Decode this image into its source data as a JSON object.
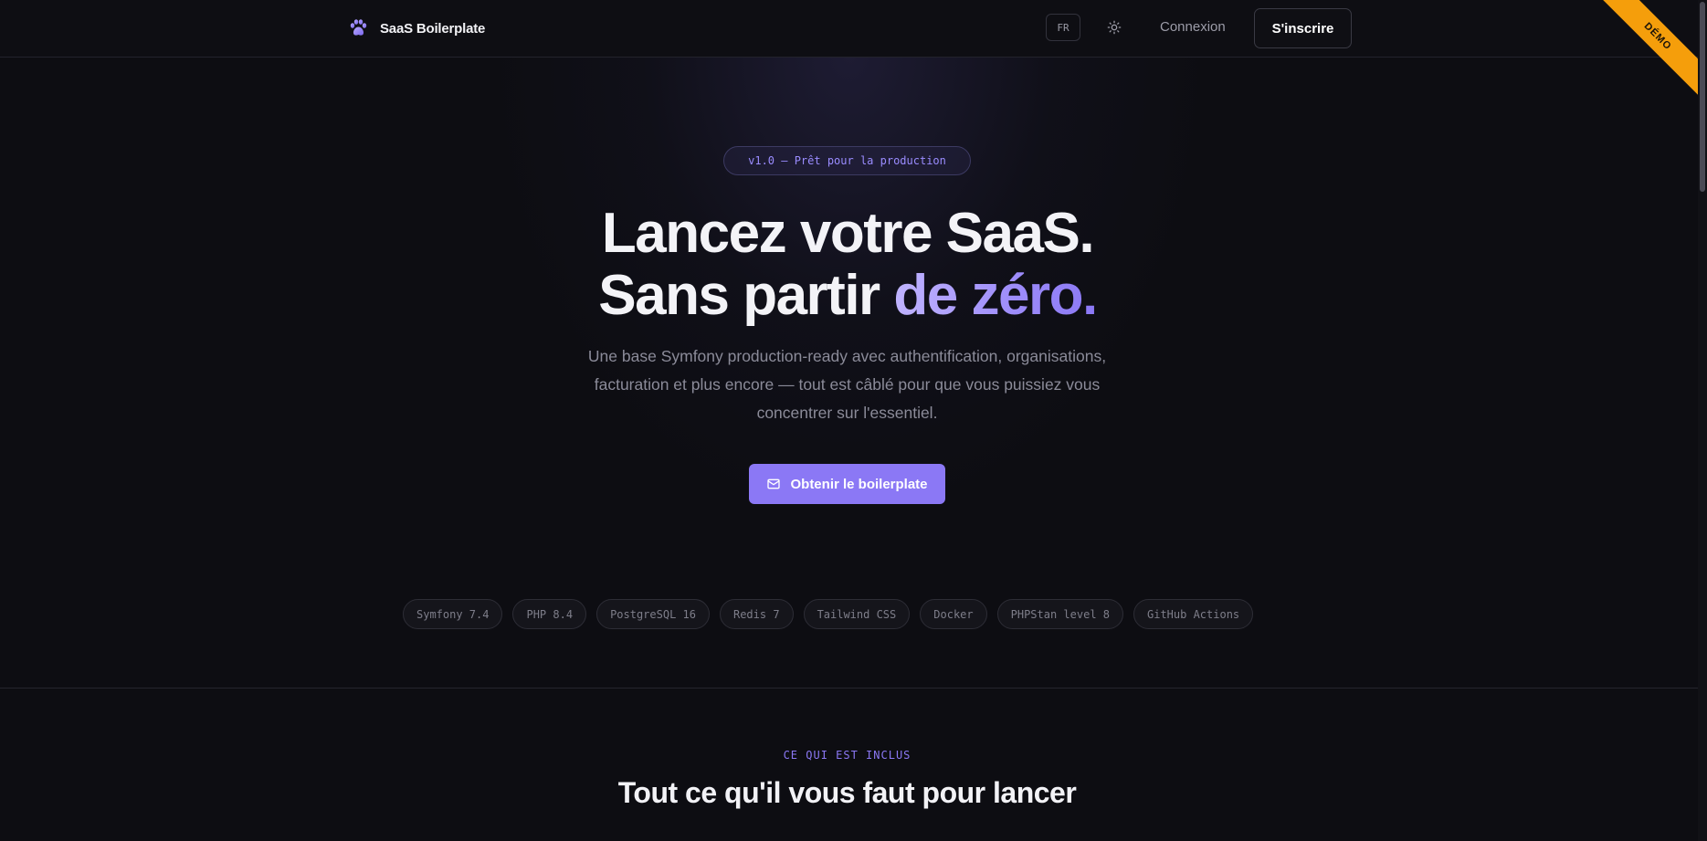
{
  "header": {
    "brand_name": "SaaS Boilerplate",
    "brand_icon": "paw-icon",
    "lang_label": "FR",
    "theme_icon": "sun-icon",
    "login_label": "Connexion",
    "signup_label": "S'inscrire",
    "ribbon_label": "DÉMO"
  },
  "hero": {
    "version_pill": "v1.0 — Prêt pour la production",
    "title_line1": "Lancez votre SaaS.",
    "title_line2_plain": "Sans partir ",
    "title_line2_accent": "de zéro.",
    "subtitle": "Une base Symfony production-ready avec authentification, organisations, facturation et plus encore — tout est câblé pour que vous puissiez vous concentrer sur l'essentiel.",
    "cta_label": "Obtenir le boilerplate",
    "cta_icon": "mail-icon"
  },
  "tech_stack": [
    "Symfony 7.4",
    "PHP 8.4",
    "PostgreSQL 16",
    "Redis 7",
    "Tailwind CSS",
    "Docker",
    "PHPStan level 8",
    "GitHub Actions"
  ],
  "features": {
    "eyebrow": "CE QUI EST INCLUS",
    "title": "Tout ce qu'il vous faut pour lancer"
  },
  "colors": {
    "accent": "#8b78f5",
    "background": "#0d0d12",
    "ribbon": "#f59e0b"
  }
}
